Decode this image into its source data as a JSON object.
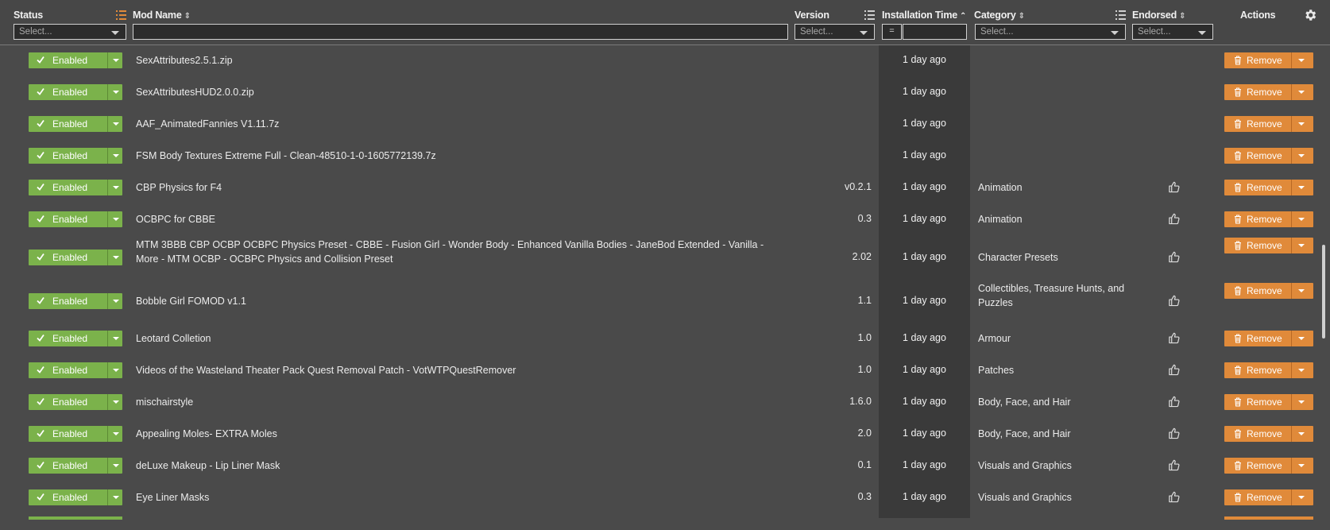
{
  "header": {
    "status_label": "Status",
    "status_select": "Select...",
    "modname_label": "Mod Name",
    "version_label": "Version",
    "version_select": "Select...",
    "install_label": "Installation Time",
    "install_eq": "=",
    "category_label": "Category",
    "category_select": "Select...",
    "endorsed_label": "Endorsed",
    "endorsed_select": "Select...",
    "actions_label": "Actions",
    "sort_both": "⇕",
    "sort_up": "⌃"
  },
  "status_label": "Enabled",
  "remove_label": "Remove",
  "colors": {
    "enabled": "#7bb24b",
    "remove": "#e08a3a"
  },
  "rows": [
    {
      "name": "SexAttributes2.5.1.zip",
      "version": "",
      "time": "1 day ago",
      "category": "",
      "endorsable": false
    },
    {
      "name": "SexAttributesHUD2.0.0.zip",
      "version": "",
      "time": "1 day ago",
      "category": "",
      "endorsable": false
    },
    {
      "name": "AAF_AnimatedFannies V1.11.7z",
      "version": "",
      "time": "1 day ago",
      "category": "",
      "endorsable": false
    },
    {
      "name": "FSM Body Textures Extreme Full - Clean-48510-1-0-1605772139.7z",
      "version": "",
      "time": "1 day ago",
      "category": "",
      "endorsable": false
    },
    {
      "name": "CBP Physics for F4",
      "version": "v0.2.1",
      "time": "1 day ago",
      "category": "Animation",
      "endorsable": true
    },
    {
      "name": "OCBPC for CBBE",
      "version": "0.3",
      "time": "1 day ago",
      "category": "Animation",
      "endorsable": true
    },
    {
      "name": "MTM 3BBB CBP OCBP OCBPC Physics Preset - CBBE - Fusion Girl - Wonder Body - Enhanced Vanilla Bodies - JaneBod Extended - Vanilla - More - MTM OCBP - OCBPC Physics and Collision Preset",
      "version": "2.02",
      "time": "1 day ago",
      "category": "Character Presets",
      "endorsable": true
    },
    {
      "name": "Bobble Girl FOMOD v1.1",
      "version": "1.1",
      "time": "1 day ago",
      "category": "Collectibles, Treasure Hunts, and Puzzles",
      "endorsable": true
    },
    {
      "name": "Leotard Colletion",
      "version": "1.0",
      "time": "1 day ago",
      "category": "Armour",
      "endorsable": true
    },
    {
      "name": "Videos of the Wasteland Theater Pack Quest Removal Patch - VotWTPQuestRemover",
      "version": "1.0",
      "time": "1 day ago",
      "category": "Patches",
      "endorsable": true
    },
    {
      "name": "mischairstyle",
      "version": "1.6.0",
      "time": "1 day ago",
      "category": "Body, Face, and Hair",
      "endorsable": true
    },
    {
      "name": "Appealing Moles- EXTRA Moles",
      "version": "2.0",
      "time": "1 day ago",
      "category": "Body, Face, and Hair",
      "endorsable": true
    },
    {
      "name": "deLuxe Makeup - Lip Liner Mask",
      "version": "0.1",
      "time": "1 day ago",
      "category": "Visuals and Graphics",
      "endorsable": true
    },
    {
      "name": "Eye Liner Masks",
      "version": "0.3",
      "time": "1 day ago",
      "category": "Visuals and Graphics",
      "endorsable": true
    }
  ]
}
